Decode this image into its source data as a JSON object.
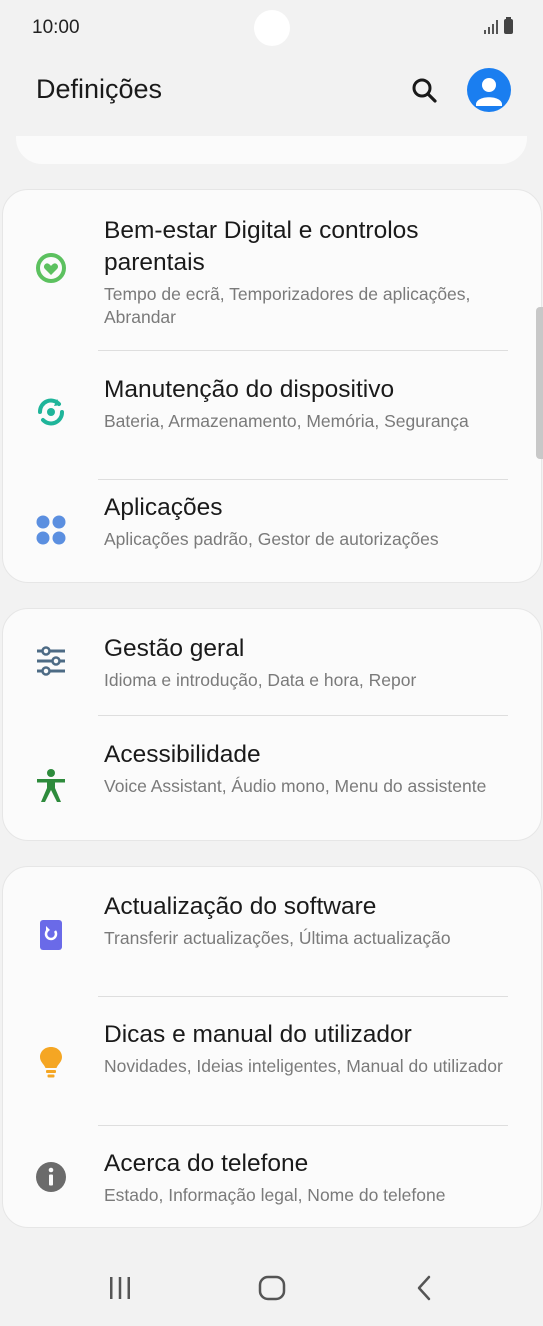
{
  "status": {
    "time": "10:00"
  },
  "app_bar": {
    "title": "Definições"
  },
  "sections": [
    {
      "items": [
        {
          "icon": "digital-wellbeing-icon",
          "title": "Bem-estar Digital e controlos parentais",
          "subtitle": "Tempo de ecrã, Temporizadores de aplicações, Abrandar"
        },
        {
          "icon": "device-care-icon",
          "title": "Manutenção do dispositivo",
          "subtitle": "Bateria, Armazenamento, Memória, Segurança"
        },
        {
          "icon": "apps-icon",
          "title": "Aplicações",
          "subtitle": "Aplicações padrão, Gestor de autorizações"
        }
      ]
    },
    {
      "items": [
        {
          "icon": "general-management-icon",
          "title": "Gestão geral",
          "subtitle": "Idioma e introdução, Data e hora, Repor"
        },
        {
          "icon": "accessibility-icon",
          "title": "Acessibilidade",
          "subtitle": "Voice Assistant, Áudio mono, Menu do assistente"
        }
      ]
    },
    {
      "items": [
        {
          "icon": "software-update-icon",
          "title": "Actualização do software",
          "subtitle": "Transferir actualizações, Última actualização"
        },
        {
          "icon": "tips-icon",
          "title": "Dicas e manual do utilizador",
          "subtitle": "Novidades, Ideias inteligentes, Manual do utilizador"
        },
        {
          "icon": "about-phone-icon",
          "title": "Acerca do telefone",
          "subtitle": "Estado, Informação legal, Nome do telefone"
        }
      ]
    }
  ],
  "colors": {
    "accent_blue": "#1a7ef0",
    "wellbeing_green": "#5cc15f",
    "device_care_teal": "#1fb59a",
    "apps_blue": "#5b8fe0",
    "general_management": "#4d6b85",
    "accessibility_green": "#2e8b3c",
    "software_update": "#6a6ae8",
    "tips_orange": "#f5a623",
    "about_gray": "#6b6b6b"
  }
}
